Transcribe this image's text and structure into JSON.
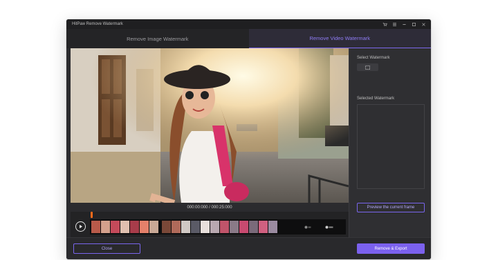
{
  "app": {
    "title": "HitPaw Remove Watermark"
  },
  "window_controls": {
    "cart_icon": "cart-icon",
    "menu_icon": "menu-icon",
    "minimize_icon": "minimize-icon",
    "maximize_icon": "maximize-icon",
    "close_icon": "close-icon"
  },
  "tabs": [
    {
      "label": "Remove Image Watermark",
      "active": false
    },
    {
      "label": "Remove Video Watermark",
      "active": true
    }
  ],
  "video": {
    "time": "000:00:000 / 000:25:000"
  },
  "side": {
    "select_label": "Select Watermark",
    "selected_label": "Selected Watermark",
    "preview_button": "Preview the current frame"
  },
  "bottom": {
    "close_button": "Close",
    "export_button": "Remove & Export"
  },
  "colors": {
    "accent": "#7b61ee",
    "playhead": "#ff6a1a",
    "background": "#2b2b2e"
  }
}
